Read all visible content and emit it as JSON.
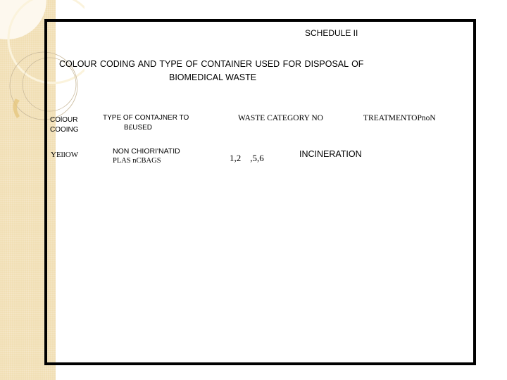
{
  "slide": {
    "schedule": "SCHEDULE  II",
    "title_line1": "COLOUR  CODING  AND  TYPE OF  CONTAINER   USED FOR DISPOSAL  OF",
    "title_line2": "BIOMEDICAL   WASTE"
  },
  "table": {
    "headers": [
      {
        "line1": "COlOUR",
        "line2": "COOING"
      },
      {
        "line1": "TYPE OF  CONTAJNER  TO",
        "line2": "B£USED"
      },
      {
        "line1": "WASTE CATEGORY  NO"
      },
      {
        "line1": "TREATMENTOPnoN"
      }
    ],
    "rows": [
      {
        "colour": "YEllOW",
        "container_line1": "NON  CHIORI'NATID",
        "container_line2": "PLAS nCBAGS",
        "category": "1,2    ,5,6",
        "treatment": "INCINERATION"
      }
    ]
  },
  "theme": {
    "sidebar_color": "#f1dfb5",
    "border_color": "#000000"
  }
}
